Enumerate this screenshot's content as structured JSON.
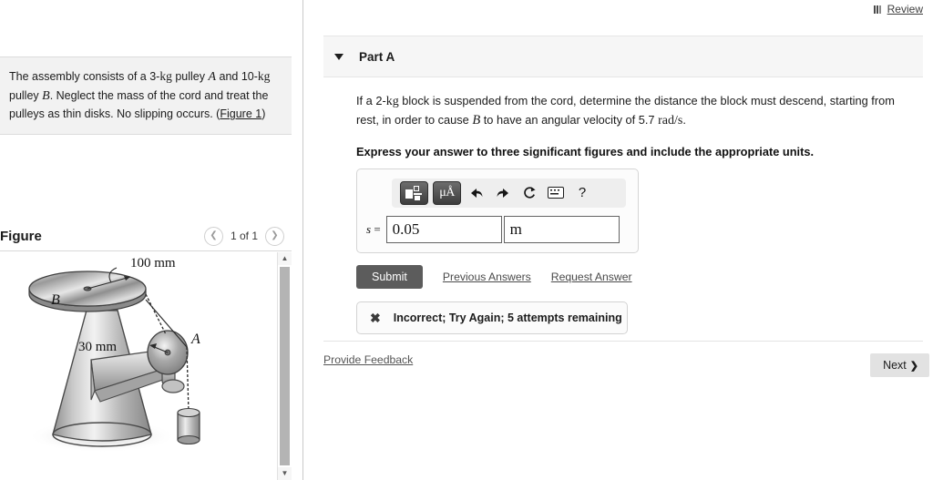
{
  "header": {
    "review_label": "Review",
    "review_icon": "bar-chart-icon"
  },
  "sidebar": {
    "statement": {
      "text_part1": "The assembly consists of a 3-",
      "unit_kg1": "kg",
      "text_part2": " pulley ",
      "var_a": "A",
      "text_part3": " and 10-",
      "unit_kg2": "kg",
      "text_part4": " pulley ",
      "var_b": "B",
      "text_part5": ". Neglect the mass of the cord and treat the pulleys as thin disks. No slipping occurs. (",
      "figure_link": "Figure 1",
      "text_part6": ")"
    },
    "figure_panel": {
      "title": "Figure",
      "prev_icon": "chevron-left-icon",
      "next_icon": "chevron-right-icon",
      "page_label": "1 of 1",
      "scroll_up_icon": "triangle-up-icon",
      "scroll_down_icon": "triangle-down-icon",
      "diagram": {
        "label_b": "B",
        "label_a": "A",
        "dim_top": "100 mm",
        "dim_side": "30 mm"
      }
    }
  },
  "main": {
    "part": {
      "caret_icon": "caret-down-icon",
      "title": "Part A",
      "prompt_1": "If a 2-",
      "prompt_kg": "kg",
      "prompt_2": " block is suspended from the cord, determine the distance the block must descend, starting from rest, in order to cause ",
      "prompt_var_b": "B",
      "prompt_3": " to have an angular velocity of 5.7 ",
      "prompt_units": "rad/s",
      "prompt_4": ".",
      "instruction": "Express your answer to three significant figures and include the appropriate units."
    },
    "answer": {
      "toolbar": {
        "template_icon": "math-template-icon",
        "units_icon": "micro-angstrom-units-icon",
        "units_label": "μÅ",
        "undo_icon": "undo-arrow-icon",
        "undo_glyph": "↖",
        "redo_icon": "redo-arrow-icon",
        "redo_glyph": "↗",
        "reset_icon": "reset-circular-arrow-icon",
        "reset_glyph": "↻",
        "keyboard_icon": "keyboard-icon",
        "help_icon": "question-mark-icon",
        "help_glyph": "?"
      },
      "label": "s",
      "equals": " =",
      "value": "0.05",
      "units": "m",
      "value_placeholder": "",
      "units_placeholder": ""
    },
    "actions": {
      "submit_label": "Submit",
      "previous_answers_label": "Previous Answers",
      "request_answer_label": "Request Answer"
    },
    "alert": {
      "icon": "x-mark-icon",
      "glyph": "✖",
      "message": "Incorrect; Try Again; 5 attempts remaining"
    },
    "footer": {
      "feedback_label": "Provide Feedback",
      "next_label": "Next",
      "next_icon": "chevron-right-icon",
      "next_glyph": "❯"
    }
  },
  "colors": {
    "submit_bg": "#5c5c5c",
    "panel_header_bg": "#f6f6f6",
    "statement_bg": "#f2f2f2",
    "next_bg": "#e2e2e2"
  }
}
